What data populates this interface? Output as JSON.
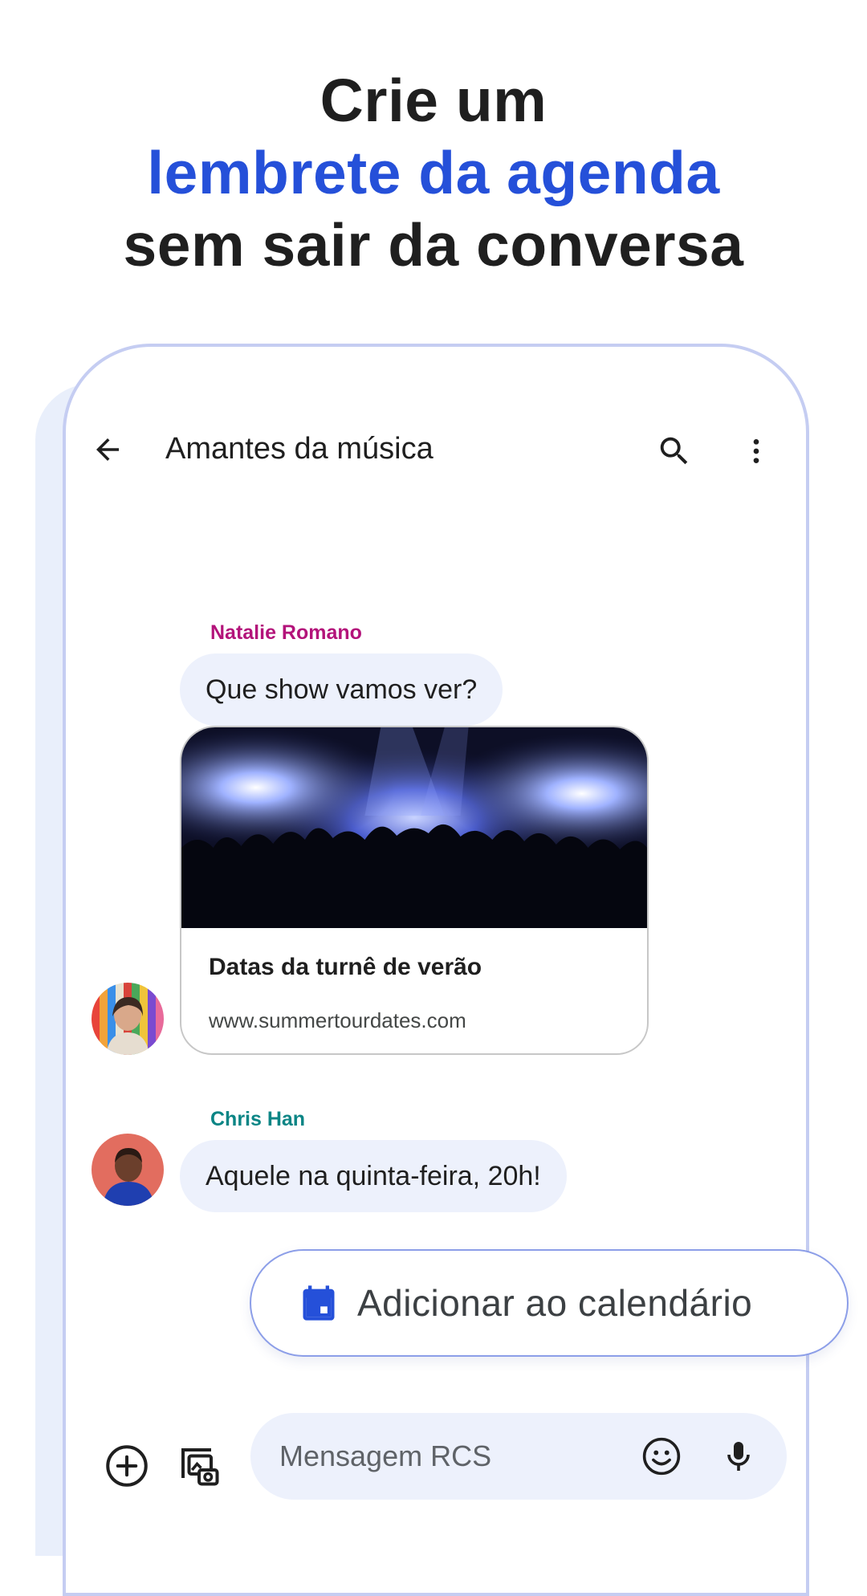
{
  "headline": {
    "line1": "Crie um",
    "line2": "lembrete da agenda",
    "line3": "sem sair da conversa"
  },
  "topbar": {
    "title": "Amantes da música",
    "back_icon": "arrow-back-icon",
    "search_icon": "search-icon",
    "menu_icon": "more-vert-icon"
  },
  "messages": [
    {
      "sender": "Natalie Romano",
      "sender_color": "#b3137a",
      "text": "Que show vamos ver?",
      "link_card": {
        "title": "Datas da turnê de verão",
        "url": "www.summertourdates.com"
      }
    },
    {
      "sender": "Chris Han",
      "sender_color": "#0b8585",
      "text": "Aquele na quinta-feira, 20h!"
    }
  ],
  "suggestion": {
    "label": "Adicionar ao calendário",
    "icon": "calendar-icon",
    "icon_color": "#2550d9"
  },
  "composer": {
    "placeholder": "Mensagem RCS",
    "add_icon": "add-circle-icon",
    "media_icon": "gallery-camera-icon",
    "emoji_icon": "emoji-icon",
    "mic_icon": "mic-icon"
  },
  "colors": {
    "accent": "#2550d9",
    "bubble": "#edf1fc",
    "phone_border": "#c5cdf2"
  }
}
